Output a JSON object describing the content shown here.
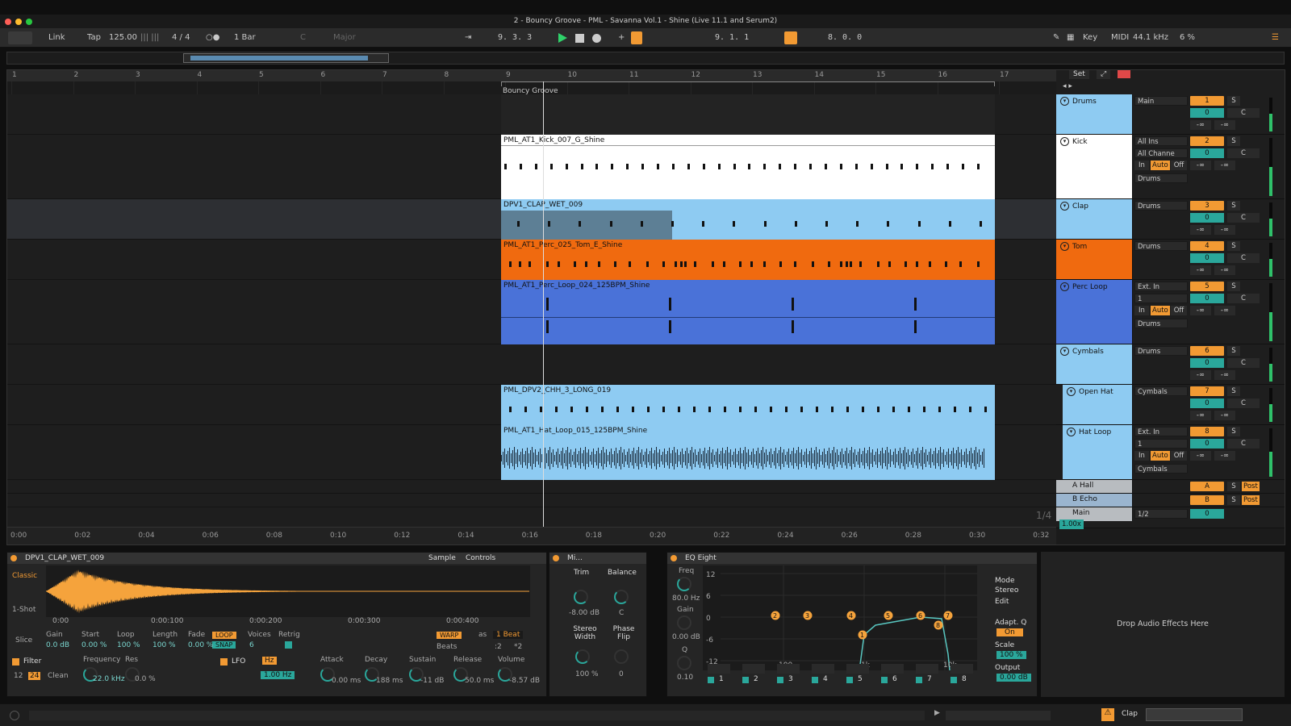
{
  "window": {
    "title": "2 - Bouncy Groove - PML - Savanna Vol.1 - Shine (Live 11.1 and Serum2)"
  },
  "controlbar": {
    "link": "Link",
    "tap": "Tap",
    "tempo": "125.00",
    "signature": "4 / 4",
    "quantize": "1 Bar",
    "key": "C",
    "scale": "Major",
    "position": "9.   3.   3",
    "loop_start": "9.   1.   1",
    "loop_length": "8.   0.   0",
    "key_label": "Key",
    "midi_label": "MIDI",
    "sample_rate": "44.1 kHz",
    "cpu": "6 %"
  },
  "ruler": {
    "bars": [
      "1",
      "2",
      "3",
      "4",
      "5",
      "6",
      "7",
      "8",
      "9",
      "10",
      "11",
      "12",
      "13",
      "14",
      "15",
      "16",
      "17"
    ]
  },
  "locator": {
    "name": "Bouncy Groove"
  },
  "clips": [
    {
      "name": "PML_AT1_Kick_007_G_Shine"
    },
    {
      "name": "DPV1_CLAP_WET_009"
    },
    {
      "name": "PML_AT1_Perc_025_Tom_E_Shine"
    },
    {
      "name": "PML_AT1_Perc_Loop_024_125BPM_Shine"
    },
    {
      "name": "PML_DPV2_CHH_3_LONG_019"
    },
    {
      "name": "PML_AT1_Hat_Loop_015_125BPM_Shine"
    }
  ],
  "timeline": {
    "labels": [
      "0:00",
      "0:02",
      "0:04",
      "0:06",
      "0:08",
      "0:10",
      "0:12",
      "0:14",
      "0:16",
      "0:18",
      "0:20",
      "0:22",
      "0:24",
      "0:26",
      "0:28",
      "0:30",
      "0:32"
    ],
    "zoom_fraction": "1/4"
  },
  "mixer": {
    "set_label": "Set",
    "tracks": [
      {
        "name": "Drums",
        "routing": "Main",
        "number": "1",
        "volume": "0",
        "pan": "C",
        "color": "#8ecbf2"
      },
      {
        "name": "Kick",
        "routing": "All Ins",
        "sub": "All Channe",
        "group": "Drums",
        "number": "2",
        "volume": "0",
        "pan": "C",
        "color": "#ffffff"
      },
      {
        "name": "Clap",
        "routing": "Drums",
        "number": "3",
        "volume": "0",
        "pan": "C",
        "color": "#8ecbf2"
      },
      {
        "name": "Tom",
        "routing": "Drums",
        "number": "4",
        "volume": "0",
        "pan": "C",
        "color": "#f06a0f"
      },
      {
        "name": "Perc Loop",
        "routing": "Ext. In",
        "sub": "1",
        "group": "Drums",
        "number": "5",
        "volume": "0",
        "pan": "C",
        "color": "#4a72d8"
      },
      {
        "name": "Cymbals",
        "routing": "Drums",
        "number": "6",
        "volume": "0",
        "pan": "C",
        "color": "#8ecbf2"
      },
      {
        "name": "Open Hat",
        "routing": "Cymbals",
        "number": "7",
        "volume": "0",
        "pan": "C",
        "color": "#8ecbf2"
      },
      {
        "name": "Hat Loop",
        "routing": "Ext. In",
        "sub": "1",
        "group": "Cymbals",
        "number": "8",
        "volume": "0",
        "pan": "C",
        "color": "#8ecbf2"
      }
    ],
    "returns": [
      {
        "name": "A Hall",
        "letter": "A",
        "post": "Post"
      },
      {
        "name": "B Echo",
        "letter": "B",
        "post": "Post"
      }
    ],
    "main": {
      "name": "Main",
      "cue": "1/2",
      "volume": "0",
      "tempo_scale": "1.00x"
    },
    "in": "In",
    "auto": "Auto",
    "off": "Off",
    "solo": "S",
    "inf": "-∞"
  },
  "simpler": {
    "title": "DPV1_CLAP_WET_009",
    "tab_sample": "Sample",
    "tab_controls": "Controls",
    "mode": "Classic",
    "oneshot": "1-Shot",
    "slice": "Slice",
    "times": [
      "0:00",
      "0:00:100",
      "0:00:200",
      "0:00:300",
      "0:00:400"
    ],
    "params": [
      {
        "l": "Gain",
        "v": "0.0 dB"
      },
      {
        "l": "Start",
        "v": "0.00 %"
      },
      {
        "l": "Loop",
        "v": "100 %"
      },
      {
        "l": "Length",
        "v": "100 %"
      },
      {
        "l": "Fade",
        "v": "0.00 %"
      }
    ],
    "loop": "LOOP",
    "snap": "SNAP",
    "voices_label": "Voices",
    "voices": "6",
    "retrig": "Retrig",
    "warp": "WARP",
    "as": "as",
    "beat": "1 Beat",
    "beats": "Beats",
    "div2": ":2",
    "mul2": "*2",
    "filter": "Filter",
    "freq_label": "Frequency",
    "res_label": "Res",
    "freq": "22.0 kHz",
    "res": "0.0 %",
    "f12": "12",
    "f24": "24",
    "clean": "Clean",
    "lfo": "LFO",
    "hz": "Hz",
    "lfo_rate": "1.00 Hz",
    "env": [
      {
        "l": "Attack",
        "v": "0.00 ms"
      },
      {
        "l": "Decay",
        "v": "188 ms"
      },
      {
        "l": "Sustain",
        "v": "-11 dB"
      },
      {
        "l": "Release",
        "v": "50.0 ms"
      },
      {
        "l": "Volume",
        "v": "-8.57 dB"
      }
    ]
  },
  "utility": {
    "title": "Mi...",
    "trim": "Trim",
    "balance": "Balance",
    "trim_v": "-8.00 dB",
    "bal_v": "C",
    "width": "Stereo Width",
    "width_v": "100 %",
    "phase": "Phase Flip",
    "phase_v": "0"
  },
  "eq": {
    "title": "EQ Eight",
    "freq_label": "Freq",
    "freq": "80.0 Hz",
    "gain_label": "Gain",
    "gain": "0.00 dB",
    "q_label": "Q",
    "q": "0.10",
    "db_scale": [
      "12",
      "6",
      "0",
      "-6",
      "-12"
    ],
    "freqs": [
      "100",
      "1k",
      "10k"
    ],
    "mode_label": "Mode",
    "mode": "Stereo",
    "edit": "Edit",
    "adapt": "Adapt. Q",
    "adapt_v": "On",
    "scale_label": "Scale",
    "scale": "100 %",
    "output_label": "Output",
    "output": "0.00 dB",
    "bands": [
      "1",
      "2",
      "3",
      "4",
      "5",
      "6",
      "7",
      "8"
    ]
  },
  "drop_text": "Drop Audio Effects Here",
  "status": {
    "track": "Clap"
  }
}
